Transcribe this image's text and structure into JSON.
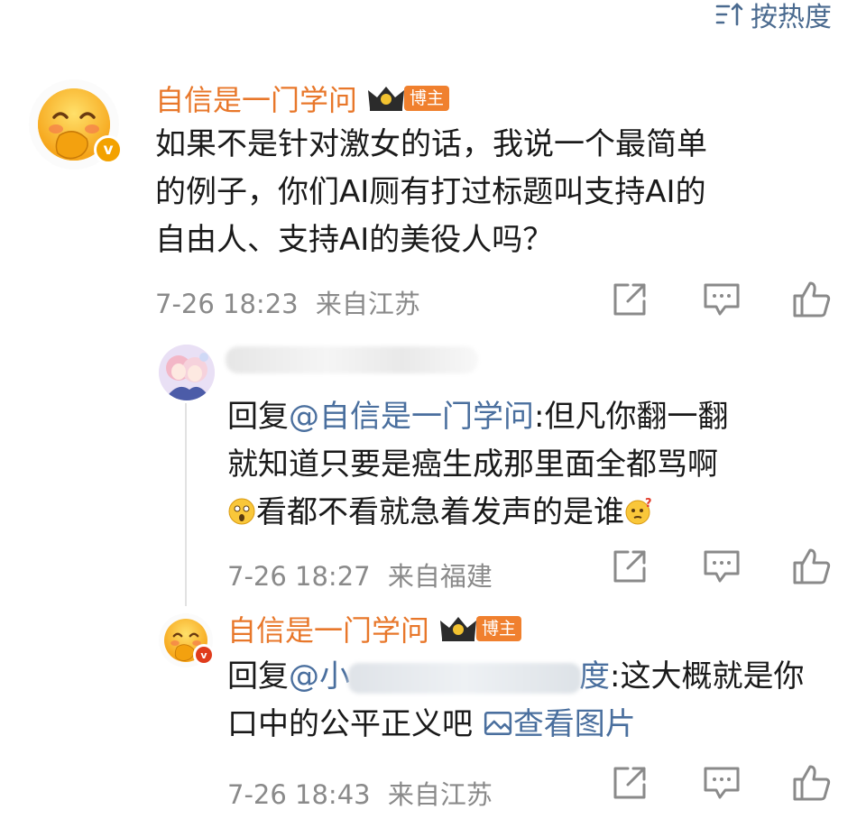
{
  "sort": {
    "label": "按热度"
  },
  "comment": {
    "author": "自信是一门学问",
    "badge": "博主",
    "text_line1": "如果不是针对激女的话，我说一个最简单",
    "text_line2": "的例子，你们AI厕有打过标题叫支持AI的",
    "text_line3": "自由人、支持AI的美役人吗？",
    "time": "7-26 18:23",
    "location": "来自江苏"
  },
  "replies": [
    {
      "author": "",
      "reply_prefix": "回复",
      "mention": "@自信是一门学问",
      "text_line1": ":但凡你翻一翻",
      "text_line2": "就知道只要是癌生成那里面全都骂啊",
      "text_line3": "看都不看就急着发声的是谁",
      "time": "7-26 18:27",
      "location": "来自福建"
    },
    {
      "author": "自信是一门学问",
      "badge": "博主",
      "reply_prefix": "回复",
      "mention_start": "@小",
      "mention_end": "度",
      "text_line1": ":这大概就是你",
      "text_line2": "口中的公平正义吧",
      "picture_link": "查看图片",
      "time": "7-26 18:43",
      "location": "来自江苏"
    }
  ],
  "colors": {
    "name": "#e8772a",
    "link": "#4a6f9e",
    "meta": "#8a8a8a",
    "badge": "#f0802e"
  },
  "icons": [
    "sort-icon",
    "crown-icon",
    "verified-icon",
    "share-icon",
    "comment-icon",
    "like-icon",
    "picture-icon",
    "emoji-surprised-icon",
    "emoji-question-icon"
  ]
}
